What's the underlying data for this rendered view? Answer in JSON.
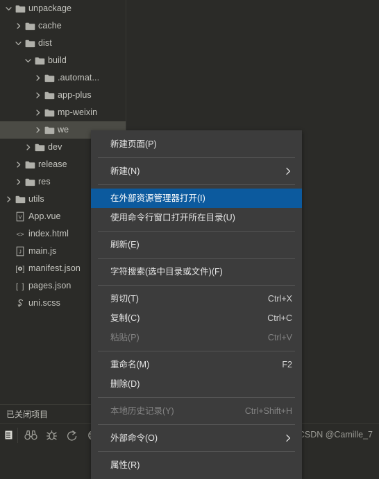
{
  "window": {
    "background_color": "#2b2b28",
    "accent_color": "#0c5a9e"
  },
  "sidebar": {
    "tree": [
      {
        "label": "unpackage",
        "depth": 0,
        "type": "folder",
        "twisty": "down",
        "selected": false
      },
      {
        "label": "cache",
        "depth": 1,
        "type": "folder",
        "twisty": "right",
        "selected": false
      },
      {
        "label": "dist",
        "depth": 1,
        "type": "folder",
        "twisty": "down",
        "selected": false
      },
      {
        "label": "build",
        "depth": 2,
        "type": "folder",
        "twisty": "down",
        "selected": false
      },
      {
        "label": ".automat...",
        "depth": 3,
        "type": "folder",
        "twisty": "right",
        "selected": false
      },
      {
        "label": "app-plus",
        "depth": 3,
        "type": "folder",
        "twisty": "right",
        "selected": false
      },
      {
        "label": "mp-weixin",
        "depth": 3,
        "type": "folder",
        "twisty": "right",
        "selected": false
      },
      {
        "label": "we",
        "depth": 3,
        "type": "folder",
        "twisty": "right",
        "selected": true
      },
      {
        "label": "dev",
        "depth": 2,
        "type": "folder",
        "twisty": "right",
        "selected": false
      },
      {
        "label": "release",
        "depth": 1,
        "type": "folder",
        "twisty": "right",
        "selected": false
      },
      {
        "label": "res",
        "depth": 1,
        "type": "folder",
        "twisty": "right",
        "selected": false
      },
      {
        "label": "utils",
        "depth": 0,
        "type": "folder",
        "twisty": "right",
        "selected": false
      },
      {
        "label": "App.vue",
        "depth": 0,
        "type": "vue",
        "twisty": "none",
        "selected": false
      },
      {
        "label": "index.html",
        "depth": 0,
        "type": "html",
        "twisty": "none",
        "selected": false
      },
      {
        "label": "main.js",
        "depth": 0,
        "type": "js",
        "twisty": "none",
        "selected": false
      },
      {
        "label": "manifest.json",
        "depth": 0,
        "type": "config",
        "twisty": "none",
        "selected": false
      },
      {
        "label": "pages.json",
        "depth": 0,
        "type": "json",
        "twisty": "none",
        "selected": false
      },
      {
        "label": "uni.scss",
        "depth": 0,
        "type": "scss",
        "twisty": "none",
        "selected": false
      }
    ]
  },
  "status_bar": {
    "text": "已关闭项目"
  },
  "bottom_bar": {
    "icons": [
      {
        "name": "panel-toggle-icon"
      },
      {
        "name": "binoculars-icon"
      },
      {
        "name": "bug-icon"
      },
      {
        "name": "run-icon"
      },
      {
        "name": "globe-icon"
      }
    ],
    "watermark": "CSDN @Camille_7"
  },
  "context_menu": {
    "items": [
      {
        "kind": "item",
        "label": "新建页面(P)",
        "shortcut": "",
        "submenu": false,
        "disabled": false,
        "highlight": false
      },
      {
        "kind": "separator"
      },
      {
        "kind": "item",
        "label": "新建(N)",
        "shortcut": "",
        "submenu": true,
        "disabled": false,
        "highlight": false
      },
      {
        "kind": "separator"
      },
      {
        "kind": "item",
        "label": "在外部资源管理器打开(I)",
        "shortcut": "",
        "submenu": false,
        "disabled": false,
        "highlight": true
      },
      {
        "kind": "item",
        "label": "使用命令行窗口打开所在目录(U)",
        "shortcut": "",
        "submenu": false,
        "disabled": false,
        "highlight": false
      },
      {
        "kind": "separator"
      },
      {
        "kind": "item",
        "label": "刷新(E)",
        "shortcut": "",
        "submenu": false,
        "disabled": false,
        "highlight": false
      },
      {
        "kind": "separator"
      },
      {
        "kind": "item",
        "label": "字符搜索(选中目录或文件)(F)",
        "shortcut": "",
        "submenu": false,
        "disabled": false,
        "highlight": false
      },
      {
        "kind": "separator"
      },
      {
        "kind": "item",
        "label": "剪切(T)",
        "shortcut": "Ctrl+X",
        "submenu": false,
        "disabled": false,
        "highlight": false
      },
      {
        "kind": "item",
        "label": "复制(C)",
        "shortcut": "Ctrl+C",
        "submenu": false,
        "disabled": false,
        "highlight": false
      },
      {
        "kind": "item",
        "label": "粘贴(P)",
        "shortcut": "Ctrl+V",
        "submenu": false,
        "disabled": true,
        "highlight": false
      },
      {
        "kind": "separator"
      },
      {
        "kind": "item",
        "label": "重命名(M)",
        "shortcut": "F2",
        "submenu": false,
        "disabled": false,
        "highlight": false
      },
      {
        "kind": "item",
        "label": "删除(D)",
        "shortcut": "",
        "submenu": false,
        "disabled": false,
        "highlight": false
      },
      {
        "kind": "separator"
      },
      {
        "kind": "item",
        "label": "本地历史记录(Y)",
        "shortcut": "Ctrl+Shift+H",
        "submenu": false,
        "disabled": true,
        "highlight": false
      },
      {
        "kind": "separator"
      },
      {
        "kind": "item",
        "label": "外部命令(O)",
        "shortcut": "",
        "submenu": true,
        "disabled": false,
        "highlight": false
      },
      {
        "kind": "separator"
      },
      {
        "kind": "item",
        "label": "属性(R)",
        "shortcut": "",
        "submenu": false,
        "disabled": false,
        "highlight": false
      }
    ]
  }
}
